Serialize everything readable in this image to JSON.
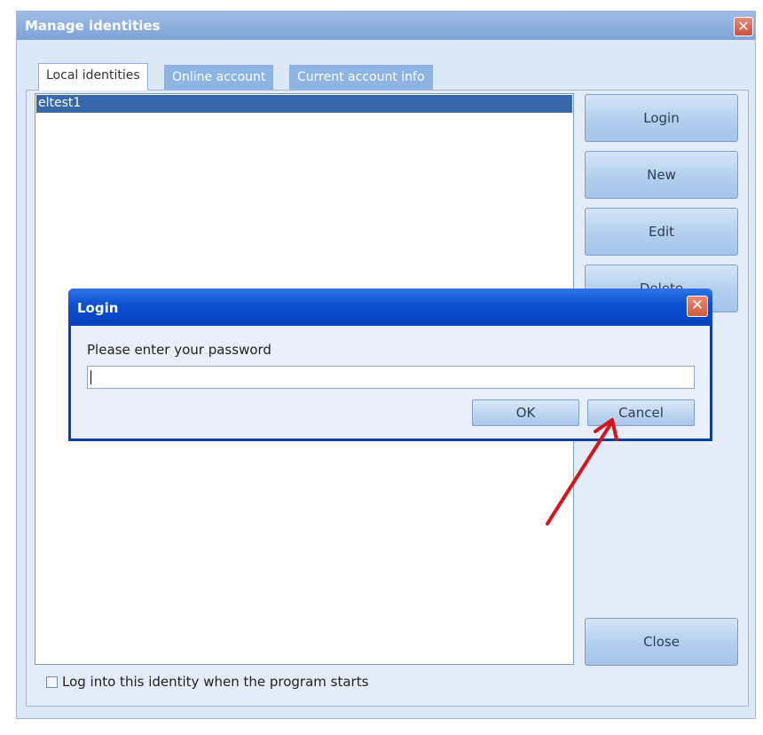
{
  "window": {
    "title": "Manage identities",
    "close_glyph": "✕"
  },
  "tabs": [
    {
      "label": "Local identities",
      "active": true
    },
    {
      "label": "Online account",
      "active": false
    },
    {
      "label": "Current account info",
      "active": false
    }
  ],
  "identity_list": {
    "items": [
      {
        "label": "eltest1",
        "selected": true
      }
    ]
  },
  "side_buttons": {
    "login": "Login",
    "new": "New",
    "edit": "Edit",
    "delete": "Delete",
    "close": "Close"
  },
  "startup_checkbox": {
    "label": "Log into this identity when the program starts",
    "checked": false
  },
  "login_dialog": {
    "title": "Login",
    "close_glyph": "✕",
    "prompt": "Please enter your password",
    "password_value": "",
    "ok_label": "OK",
    "cancel_label": "Cancel"
  },
  "annotation": {
    "type": "arrow",
    "color": "#d4141b",
    "points_to": "cancel-button"
  },
  "colors": {
    "dialog_titlebar": "#0a4fd1",
    "selection": "#3867ab",
    "button_face": "#b3ceee"
  }
}
